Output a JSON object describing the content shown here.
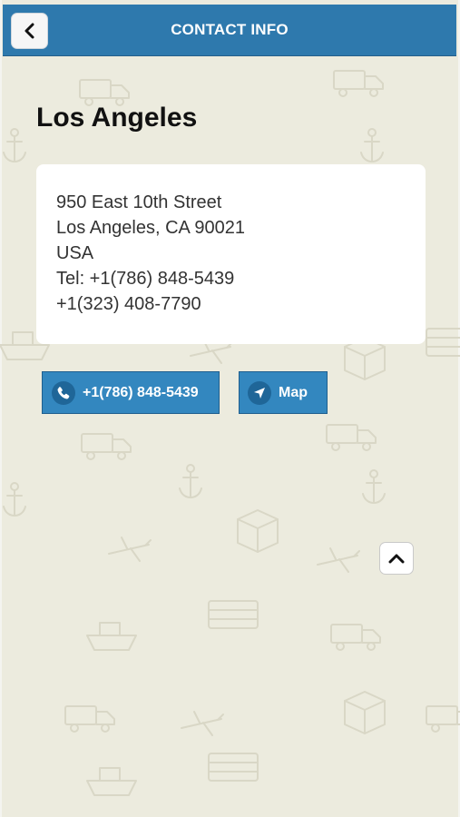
{
  "header": {
    "title": "CONTACT INFO",
    "back_icon": "chevron-left-icon",
    "color": "#2e79ad"
  },
  "location": {
    "city": "Los Angeles",
    "address_lines": [
      "950 East 10th Street",
      "Los Angeles, CA 90021",
      "USA",
      "Tel: +1(786) 848-5439",
      "+1(323) 408-7790"
    ]
  },
  "actions": {
    "call_label": "+1(786) 848-5439",
    "call_icon": "phone-icon",
    "map_label": "Map",
    "map_icon": "navigation-arrow-icon",
    "button_color": "#3387bf"
  },
  "scroll_top": {
    "icon": "chevron-up-icon"
  },
  "background": {
    "color": "#ecebde",
    "pattern": "logistics-icons-pattern"
  }
}
